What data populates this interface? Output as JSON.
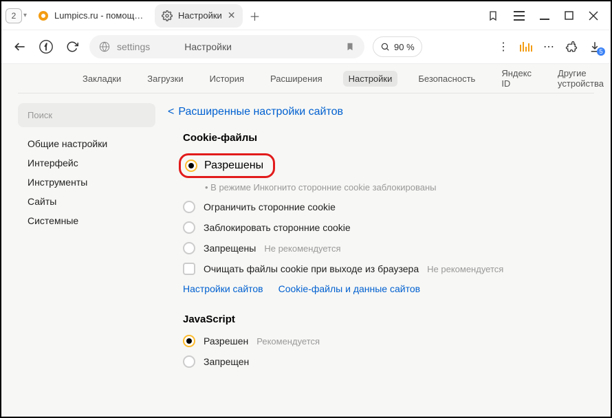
{
  "titlebar": {
    "tab_count": "2",
    "tabs": [
      {
        "label": "Lumpics.ru - помощь с ком",
        "active": false
      },
      {
        "label": "Настройки",
        "active": true
      }
    ]
  },
  "addrbar": {
    "url_text": "settings",
    "page_title": "Настройки",
    "zoom": "90 %"
  },
  "subnav": {
    "items": [
      "Закладки",
      "Загрузки",
      "История",
      "Расширения",
      "Настройки",
      "Безопасность",
      "Яндекс ID",
      "Другие устройства"
    ],
    "active_index": 4
  },
  "sidebar": {
    "search_placeholder": "Поиск",
    "items": [
      "Общие настройки",
      "Интерфейс",
      "Инструменты",
      "Сайты",
      "Системные"
    ]
  },
  "main": {
    "breadcrumb": "Расширенные настройки сайтов",
    "sections": {
      "cookies": {
        "title": "Cookie-файлы",
        "options": [
          {
            "label": "Разрешены",
            "hint": "",
            "checked": true,
            "sub_hint": "• В режиме Инкогнито сторонние cookie заблокированы"
          },
          {
            "label": "Ограничить сторонние cookie",
            "hint": "",
            "checked": false
          },
          {
            "label": "Заблокировать сторонние cookie",
            "hint": "",
            "checked": false
          },
          {
            "label": "Запрещены",
            "hint": "Не рекомендуется",
            "checked": false
          }
        ],
        "checkbox": {
          "label": "Очищать файлы cookie при выходе из браузера",
          "hint": "Не рекомендуется"
        },
        "links": [
          "Настройки сайтов",
          "Cookie-файлы и данные сайтов"
        ]
      },
      "javascript": {
        "title": "JavaScript",
        "options": [
          {
            "label": "Разрешен",
            "hint": "Рекомендуется",
            "checked": true
          },
          {
            "label": "Запрещен",
            "hint": "",
            "checked": false
          }
        ]
      }
    }
  }
}
